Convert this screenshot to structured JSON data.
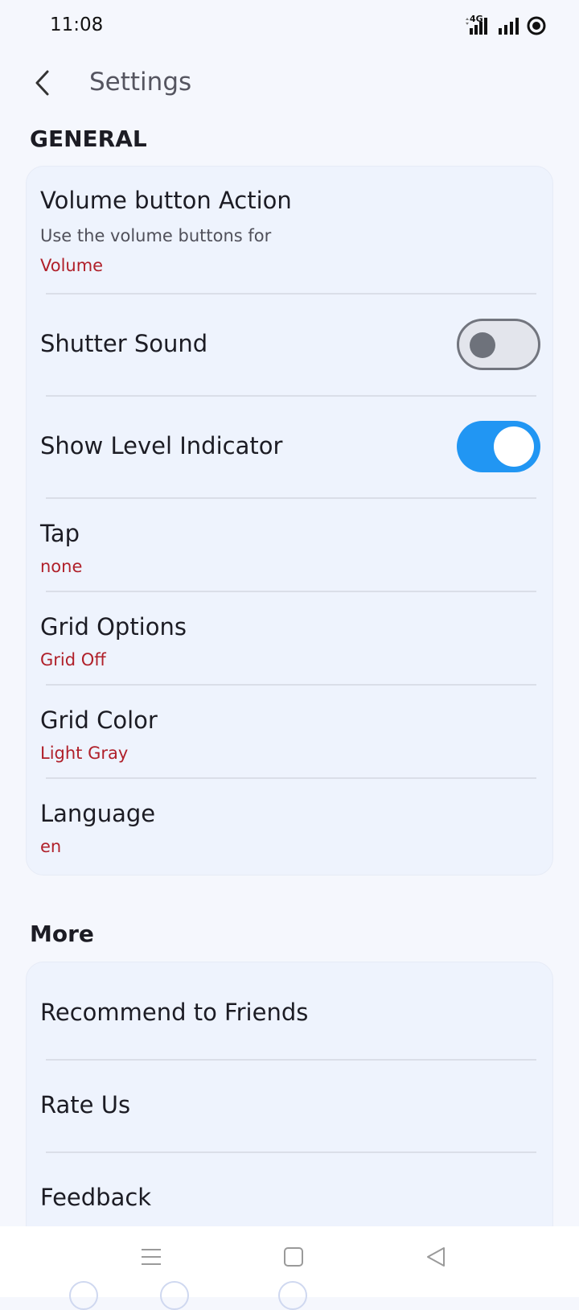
{
  "status_bar": {
    "time": "11:08",
    "network_label": "4G",
    "icons": [
      "signal-4g-icon",
      "signal-icon",
      "record-icon"
    ]
  },
  "header": {
    "title": "Settings",
    "back_icon": "chevron-left-icon"
  },
  "general": {
    "section_title": "GENERAL",
    "volume_action": {
      "title": "Volume button Action",
      "description": "Use the volume buttons for",
      "value": "Volume"
    },
    "shutter_sound": {
      "title": "Shutter Sound",
      "enabled": false
    },
    "level_indicator": {
      "title": "Show Level Indicator",
      "enabled": true
    },
    "tap": {
      "title": "Tap",
      "value": "none"
    },
    "grid_options": {
      "title": "Grid Options",
      "value": "Grid Off"
    },
    "grid_color": {
      "title": "Grid Color",
      "value": "Light Gray"
    },
    "language": {
      "title": "Language",
      "value": "en"
    }
  },
  "more": {
    "section_title": "More",
    "items": [
      {
        "label": "Recommend to Friends"
      },
      {
        "label": "Rate Us"
      },
      {
        "label": "Feedback"
      }
    ]
  },
  "nav_bar": {
    "icons": [
      "menu-icon",
      "home-square-icon",
      "back-triangle-icon"
    ]
  },
  "colors": {
    "accent": "#2196f3",
    "value_text": "#b0202a",
    "background": "#f5f7fd",
    "card": "#eef3fd"
  }
}
